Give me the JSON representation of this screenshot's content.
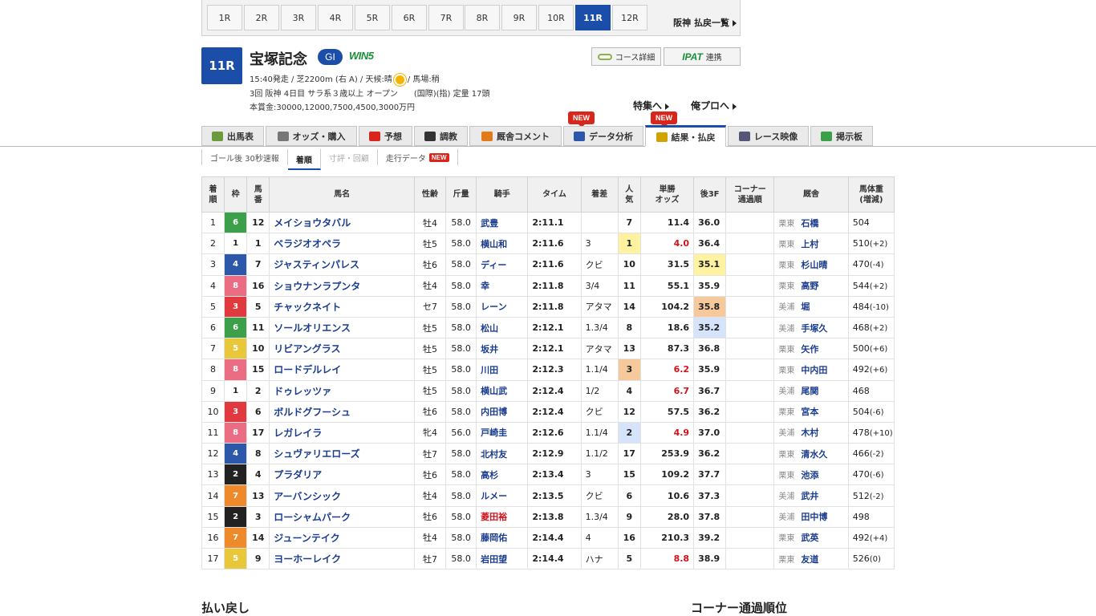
{
  "race_nav": {
    "races": [
      "1R",
      "2R",
      "3R",
      "4R",
      "5R",
      "6R",
      "7R",
      "8R",
      "9R",
      "10R",
      "11R",
      "12R"
    ],
    "active": "11R",
    "list_link": "阪神 払戻一覧"
  },
  "header": {
    "race_no": "11R",
    "race_name": "宝塚記念",
    "grade": "GI",
    "win5": "WIN5",
    "line1_a": "15:40発走 / 芝2200m (右 A) / 天候:晴",
    "line1_b": "/ 馬場:稍",
    "line2": "3回 阪神 4日目 サラ系３歳以上 オープン　　(国際)(指) 定量 17頭",
    "line3": "本賞金:30000,12000,7500,4500,3000万円",
    "course_btn": "コース詳細",
    "ipat_logo": "IPAT",
    "ipat_btn": "連携",
    "feature_link": "特集へ",
    "pro_link": "俺プロへ"
  },
  "tabs": [
    {
      "label": "出馬表",
      "icon": "entry-table-icon",
      "color": "#6a9a3b"
    },
    {
      "label": "オッズ・購入",
      "icon": "odds-icon",
      "color": "#777777"
    },
    {
      "label": "予想",
      "icon": "target-icon",
      "color": "#d8261c"
    },
    {
      "label": "調教",
      "icon": "stopwatch-icon",
      "color": "#333333"
    },
    {
      "label": "厩舎コメント",
      "icon": "stable-icon",
      "color": "#e07a1a"
    },
    {
      "label": "データ分析",
      "icon": "bar-chart-icon",
      "color": "#2d57a8"
    },
    {
      "label": "結果・払戻",
      "icon": "coins-icon",
      "color": "#d1a300"
    },
    {
      "label": "レース映像",
      "icon": "video-icon",
      "color": "#555577"
    },
    {
      "label": "掲示板",
      "icon": "chat-icon",
      "color": "#3ca04a"
    }
  ],
  "new_badge": "NEW",
  "subtabs": [
    "ゴール後 30秒速報",
    "着順",
    "寸評・回顧",
    "走行データ"
  ],
  "table": {
    "headers": [
      "着\n順",
      "枠",
      "馬\n番",
      "馬名",
      "性齢",
      "斤量",
      "騎手",
      "タイム",
      "着差",
      "人\n気",
      "単勝\nオッズ",
      "後3F",
      "コーナー\n通過順",
      "厩舎",
      "馬体重\n(増減)"
    ],
    "rows": [
      {
        "pos": "1",
        "frame": "6",
        "num": "12",
        "horse": "メイショウタバル",
        "sex_age": "牡4",
        "weight": "58.0",
        "jockey": "武豊",
        "time": "2:11.1",
        "margin": "",
        "pop": "7",
        "odds": "11.4",
        "last3f": "36.0",
        "corner": "",
        "area": "栗東",
        "trainer": "石橋",
        "body": "504",
        "diff": ""
      },
      {
        "pos": "2",
        "frame": "1",
        "num": "1",
        "horse": "ベラジオオペラ",
        "sex_age": "牡5",
        "weight": "58.0",
        "jockey": "横山和",
        "time": "2:11.6",
        "margin": "3",
        "pop": "1",
        "odds": "4.0",
        "last3f": "36.4",
        "corner": "",
        "area": "栗東",
        "trainer": "上村",
        "body": "510",
        "diff": "(+2)"
      },
      {
        "pos": "3",
        "frame": "4",
        "num": "7",
        "horse": "ジャスティンパレス",
        "sex_age": "牡6",
        "weight": "58.0",
        "jockey": "ディー",
        "time": "2:11.6",
        "margin": "クビ",
        "pop": "10",
        "odds": "31.5",
        "last3f": "35.1",
        "corner": "",
        "area": "栗東",
        "trainer": "杉山晴",
        "body": "470",
        "diff": "(-4)"
      },
      {
        "pos": "4",
        "frame": "8",
        "num": "16",
        "horse": "ショウナンラプンタ",
        "sex_age": "牡4",
        "weight": "58.0",
        "jockey": "幸",
        "time": "2:11.8",
        "margin": "3/4",
        "pop": "11",
        "odds": "55.1",
        "last3f": "35.9",
        "corner": "",
        "area": "栗東",
        "trainer": "高野",
        "body": "544",
        "diff": "(+2)"
      },
      {
        "pos": "5",
        "frame": "3",
        "num": "5",
        "horse": "チャックネイト",
        "sex_age": "セ7",
        "weight": "58.0",
        "jockey": "レーン",
        "time": "2:11.8",
        "margin": "アタマ",
        "pop": "14",
        "odds": "104.2",
        "last3f": "35.8",
        "corner": "",
        "area": "美浦",
        "trainer": "堀",
        "body": "484",
        "diff": "(-10)"
      },
      {
        "pos": "6",
        "frame": "6",
        "num": "11",
        "horse": "ソールオリエンス",
        "sex_age": "牡5",
        "weight": "58.0",
        "jockey": "松山",
        "time": "2:12.1",
        "margin": "1.3/4",
        "pop": "8",
        "odds": "18.6",
        "last3f": "35.2",
        "corner": "",
        "area": "美浦",
        "trainer": "手塚久",
        "body": "468",
        "diff": "(+2)"
      },
      {
        "pos": "7",
        "frame": "5",
        "num": "10",
        "horse": "リビアングラス",
        "sex_age": "牡5",
        "weight": "58.0",
        "jockey": "坂井",
        "time": "2:12.1",
        "margin": "アタマ",
        "pop": "13",
        "odds": "87.3",
        "last3f": "36.8",
        "corner": "",
        "area": "栗東",
        "trainer": "矢作",
        "body": "500",
        "diff": "(+6)"
      },
      {
        "pos": "8",
        "frame": "8",
        "num": "15",
        "horse": "ロードデルレイ",
        "sex_age": "牡5",
        "weight": "58.0",
        "jockey": "川田",
        "time": "2:12.3",
        "margin": "1.1/4",
        "pop": "3",
        "odds": "6.2",
        "last3f": "35.9",
        "corner": "",
        "area": "栗東",
        "trainer": "中内田",
        "body": "492",
        "diff": "(+6)"
      },
      {
        "pos": "9",
        "frame": "1",
        "num": "2",
        "horse": "ドゥレッツァ",
        "sex_age": "牡5",
        "weight": "58.0",
        "jockey": "横山武",
        "time": "2:12.4",
        "margin": "1/2",
        "pop": "4",
        "odds": "6.7",
        "last3f": "36.7",
        "corner": "",
        "area": "美浦",
        "trainer": "尾関",
        "body": "468",
        "diff": ""
      },
      {
        "pos": "10",
        "frame": "3",
        "num": "6",
        "horse": "ボルドグフーシュ",
        "sex_age": "牡6",
        "weight": "58.0",
        "jockey": "内田博",
        "time": "2:12.4",
        "margin": "クビ",
        "pop": "12",
        "odds": "57.5",
        "last3f": "36.2",
        "corner": "",
        "area": "栗東",
        "trainer": "宮本",
        "body": "504",
        "diff": "(-6)"
      },
      {
        "pos": "11",
        "frame": "8",
        "num": "17",
        "horse": "レガレイラ",
        "sex_age": "牝4",
        "weight": "56.0",
        "jockey": "戸崎圭",
        "time": "2:12.6",
        "margin": "1.1/4",
        "pop": "2",
        "odds": "4.9",
        "last3f": "37.0",
        "corner": "",
        "area": "美浦",
        "trainer": "木村",
        "body": "478",
        "diff": "(+10)"
      },
      {
        "pos": "12",
        "frame": "4",
        "num": "8",
        "horse": "シュヴァリエローズ",
        "sex_age": "牡7",
        "weight": "58.0",
        "jockey": "北村友",
        "time": "2:12.9",
        "margin": "1.1/2",
        "pop": "17",
        "odds": "253.9",
        "last3f": "36.2",
        "corner": "",
        "area": "栗東",
        "trainer": "清水久",
        "body": "466",
        "diff": "(-2)"
      },
      {
        "pos": "13",
        "frame": "2",
        "num": "4",
        "horse": "プラダリア",
        "sex_age": "牡6",
        "weight": "58.0",
        "jockey": "高杉",
        "time": "2:13.4",
        "margin": "3",
        "pop": "15",
        "odds": "109.2",
        "last3f": "37.7",
        "corner": "",
        "area": "栗東",
        "trainer": "池添",
        "body": "470",
        "diff": "(-6)"
      },
      {
        "pos": "14",
        "frame": "7",
        "num": "13",
        "horse": "アーバンシック",
        "sex_age": "牡4",
        "weight": "58.0",
        "jockey": "ルメー",
        "time": "2:13.5",
        "margin": "クビ",
        "pop": "6",
        "odds": "10.6",
        "last3f": "37.3",
        "corner": "",
        "area": "美浦",
        "trainer": "武井",
        "body": "512",
        "diff": "(-2)"
      },
      {
        "pos": "15",
        "frame": "2",
        "num": "3",
        "horse": "ローシャムパーク",
        "sex_age": "牡6",
        "weight": "58.0",
        "jockey": "菱田裕",
        "time": "2:13.8",
        "margin": "1.3/4",
        "pop": "9",
        "odds": "28.0",
        "last3f": "37.8",
        "corner": "",
        "area": "美浦",
        "trainer": "田中博",
        "body": "498",
        "diff": ""
      },
      {
        "pos": "16",
        "frame": "7",
        "num": "14",
        "horse": "ジューンテイク",
        "sex_age": "牡4",
        "weight": "58.0",
        "jockey": "藤岡佑",
        "time": "2:14.4",
        "margin": "4",
        "pop": "16",
        "odds": "210.3",
        "last3f": "39.2",
        "corner": "",
        "area": "栗東",
        "trainer": "武英",
        "body": "492",
        "diff": "(+4)"
      },
      {
        "pos": "17",
        "frame": "5",
        "num": "9",
        "horse": "ヨーホーレイク",
        "sex_age": "牡7",
        "weight": "58.0",
        "jockey": "岩田望",
        "time": "2:14.4",
        "margin": "ハナ",
        "pop": "5",
        "odds": "8.8",
        "last3f": "38.9",
        "corner": "",
        "area": "栗東",
        "trainer": "友道",
        "body": "526",
        "diff": "(0)"
      }
    ]
  },
  "sections": {
    "payout_title": "払い戻し",
    "corner_title": "コーナー通過順位"
  }
}
